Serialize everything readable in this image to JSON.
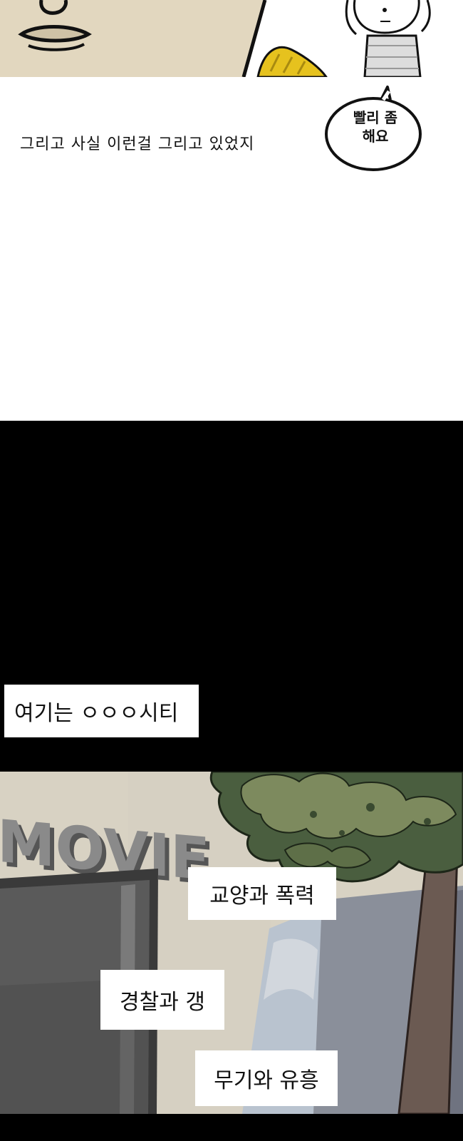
{
  "narration": {
    "text": "그리고 사실 이런걸 그리고 있었지"
  },
  "speech_bubble": {
    "text": "빨리 좀\n해요"
  },
  "captions": {
    "city": "여기는 ㅇㅇㅇ시티",
    "culture_violence": "교양과 폭력",
    "police_gang": "경찰과 갱",
    "weapons_entertainment": "무기와 유흥"
  },
  "building_sign": {
    "text": "MOVIE"
  },
  "colors": {
    "skin": "#e2d7bf",
    "hair_yellow": "#e6c21e",
    "wall": "#d8d2c3",
    "tree_dark": "#4a5e3f",
    "tree_light": "#7d8a5e",
    "trunk": "#6b5a52",
    "door": "#555555",
    "black": "#000000"
  }
}
